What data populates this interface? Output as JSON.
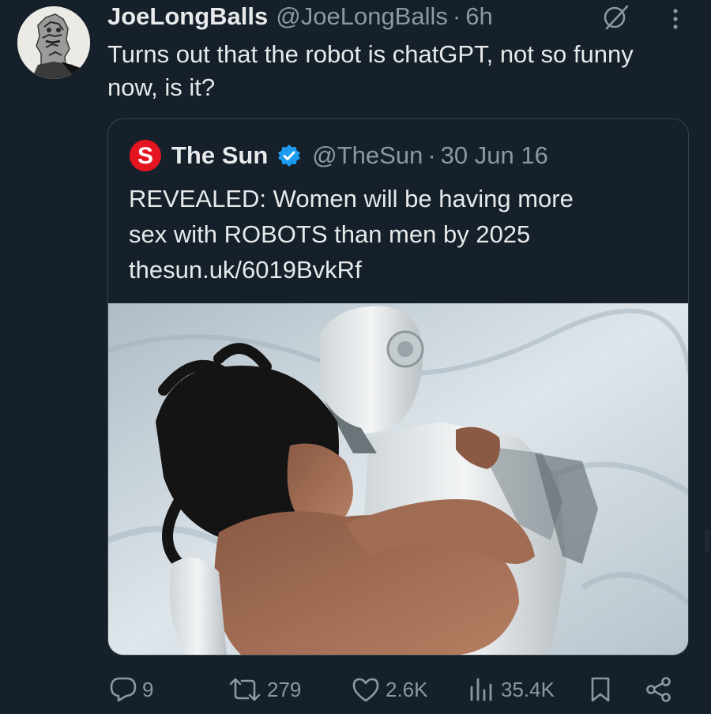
{
  "tweet": {
    "display_name": "JoeLongBalls",
    "handle": "@JoeLongBalls",
    "separator": "·",
    "time": "6h",
    "text": "Turns out that the robot is chatGPT, not so funny now, is it?"
  },
  "quoted": {
    "display_name": "The Sun",
    "handle": "@TheSun",
    "separator": "·",
    "date": "30 Jun 16",
    "text_line1": "REVEALED: Women will be having more",
    "text_line2": "sex with ROBOTS than men by 2025",
    "text_line3": "thesun.uk/6019BvkRf",
    "logo_letter": "S"
  },
  "actions": {
    "replies": "9",
    "retweets": "279",
    "likes": "2.6K",
    "views": "35.4K"
  },
  "icons": {
    "avatar": "avatar-illustration",
    "grok": "grok-icon",
    "more": "more-icon",
    "verified": "verified-badge-icon",
    "reply": "reply-icon",
    "retweet": "retweet-icon",
    "like": "heart-icon",
    "views": "views-icon",
    "bookmark": "bookmark-icon",
    "share": "share-icon"
  },
  "colors": {
    "background": "#15202b",
    "text": "#e7e9ea",
    "muted": "#8b98a5",
    "border": "#38444d",
    "verified": "#1d9bf0",
    "sun_red": "#e4151f"
  }
}
